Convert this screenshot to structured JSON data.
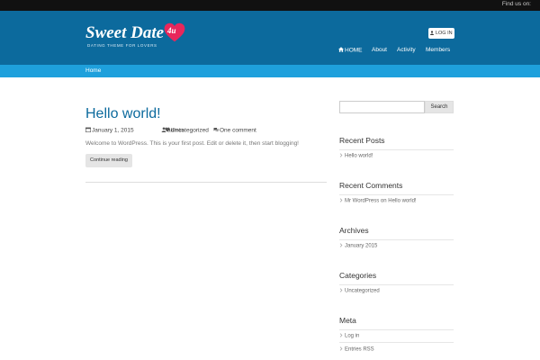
{
  "topbar": {
    "find_us": "Find us on:"
  },
  "header": {
    "logo_title": "Sweet Date",
    "logo_badge": "4u",
    "logo_tagline": "DATING THEME FOR LOVERS",
    "login_label": "LOG IN"
  },
  "nav": {
    "items": [
      {
        "label": "HOME",
        "icon": "home-icon"
      },
      {
        "label": "About"
      },
      {
        "label": "Activity"
      },
      {
        "label": "Members"
      }
    ]
  },
  "breadcrumb": {
    "home": "Home"
  },
  "post": {
    "title": "Hello world!",
    "date": "January 1, 2015",
    "author": "admin",
    "category": "Uncategorized",
    "comments": "One comment",
    "excerpt": "Welcome to WordPress. This is your first post. Edit or delete it, then start blogging!",
    "continue_label": "Continue reading"
  },
  "sidebar": {
    "search_placeholder": "",
    "search_button": "Search",
    "recent_posts": {
      "title": "Recent Posts",
      "items": [
        "Hello world!"
      ]
    },
    "recent_comments": {
      "title": "Recent Comments",
      "items": [
        "Mr WordPress on Hello world!"
      ]
    },
    "archives": {
      "title": "Archives",
      "items": [
        "January 2015"
      ]
    },
    "categories": {
      "title": "Categories",
      "items": [
        "Uncategorized"
      ]
    },
    "meta": {
      "title": "Meta",
      "items": [
        "Log in",
        "Entries RSS"
      ]
    }
  },
  "colors": {
    "header_bg": "#0c6a9d",
    "breadcrumb_bg": "#1ea0dc",
    "heart": "#e8275b",
    "link": "#0c6a9d"
  }
}
